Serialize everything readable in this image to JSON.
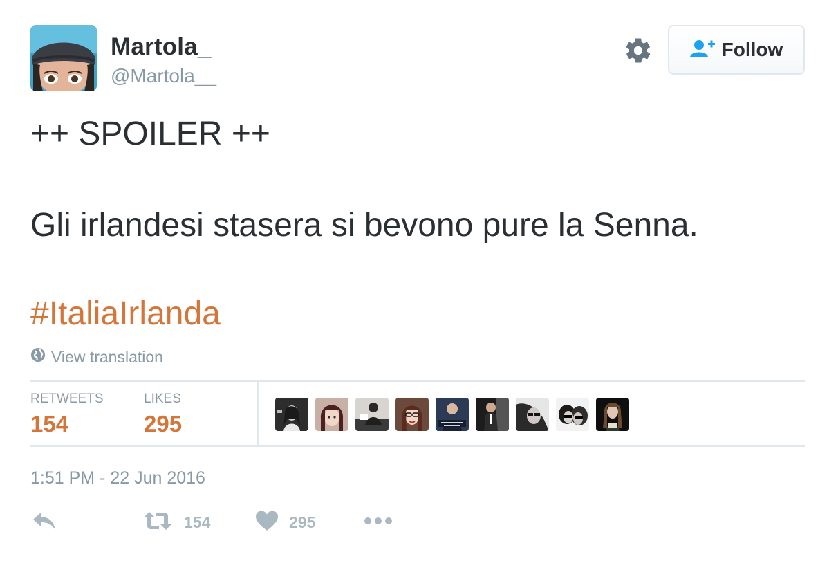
{
  "user": {
    "display_name": "Martola_",
    "screen_name": "@Martola__"
  },
  "follow_button": {
    "label": "Follow"
  },
  "tweet": {
    "lines": [
      "++ SPOILER ++",
      "Gli irlandesi stasera si bevono pure la Senna."
    ],
    "hashtag": "#ItaliaIrlanda",
    "translate_label": "View translation",
    "timestamp": "1:51 PM - 22 Jun 2016"
  },
  "stats": {
    "retweets_label": "RETWEETS",
    "retweets_value": "154",
    "likes_label": "LIKES",
    "likes_value": "295"
  },
  "actions": {
    "retweet_count": "154",
    "like_count": "295"
  },
  "colors": {
    "link": "#d4763a",
    "muted": "#8899a6",
    "action_icon": "#aab8c2",
    "follow_icon": "#1da1f2"
  },
  "icons": {
    "settings": "gear-icon",
    "follow": "add-user-icon",
    "translate": "globe-icon",
    "reply": "reply-icon",
    "retweet": "retweet-icon",
    "like": "heart-icon",
    "more": "more-dots-icon"
  },
  "liker_avatars_count": 9
}
